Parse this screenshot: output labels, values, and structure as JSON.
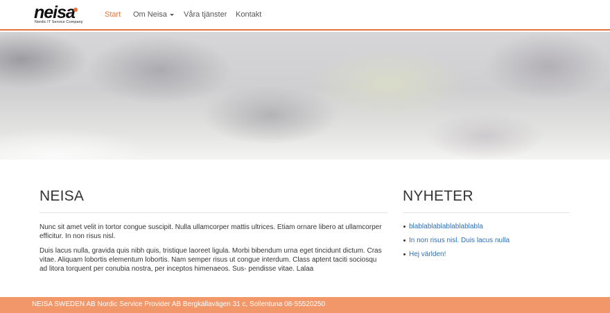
{
  "logo": {
    "word": "neisa",
    "tagline": "Nordic IT Service Company"
  },
  "nav": {
    "items": [
      {
        "label": "Start",
        "active": true
      },
      {
        "label": "Om Neisa",
        "dropdown": true
      },
      {
        "label": "Våra tjänster"
      },
      {
        "label": "Kontakt"
      }
    ]
  },
  "main": {
    "title": "NEISA",
    "paragraphs": [
      "Nunc sit amet velit in tortor congue suscipit. Nulla ullamcorper mattis ultrices. Etiam ornare libero at ullamcorper efficitur. In non risus nisl.",
      "Duis lacus nulla, gravida quis nibh quis, tristique laoreet ligula. Morbi bibendum urna eget tincidunt dictum. Cras vitae. Aliquam lobortis elementum lobortis. Nam semper risus ut congue interdum. Class aptent taciti sociosqu ad litora torquent per conubia nostra, per inceptos himenaeos. Sus- pendisse vitae. Lalaa"
    ]
  },
  "news": {
    "title": "NYHETER",
    "items": [
      "blablablablablablablabla",
      "In non risus nisl. Duis lacus nulla",
      "Hej världen!"
    ]
  },
  "footer": {
    "text": "NEISA SWEDEN AB Nordic Service Provider AB Bergkällavägen 31 c, Sollentuna 08-55520250"
  },
  "colors": {
    "accent": "#e8733a",
    "footer": "#f2976a",
    "link": "#2a6ebb"
  }
}
